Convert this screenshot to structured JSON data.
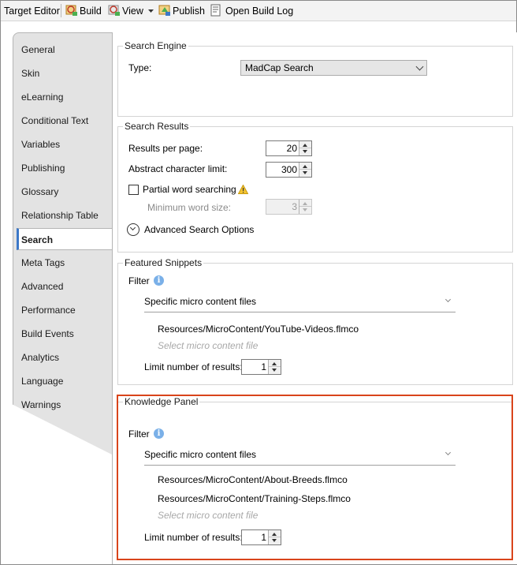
{
  "toolbar": {
    "title": "Target Editor",
    "build": "Build",
    "view": "View",
    "publish": "Publish",
    "open_build_log": "Open Build Log"
  },
  "nav": {
    "items": [
      {
        "label": "General"
      },
      {
        "label": "Skin"
      },
      {
        "label": "eLearning"
      },
      {
        "label": "Conditional Text"
      },
      {
        "label": "Variables"
      },
      {
        "label": "Publishing"
      },
      {
        "label": "Glossary"
      },
      {
        "label": "Relationship Table"
      },
      {
        "label": "Search",
        "active": true
      },
      {
        "label": "Meta Tags"
      },
      {
        "label": "Advanced"
      },
      {
        "label": "Performance"
      },
      {
        "label": "Build Events"
      },
      {
        "label": "Analytics"
      },
      {
        "label": "Language"
      },
      {
        "label": "Warnings"
      }
    ]
  },
  "search_engine": {
    "legend": "Search Engine",
    "type_label": "Type:",
    "type_value": "MadCap Search"
  },
  "search_results": {
    "legend": "Search Results",
    "results_per_page_label": "Results per page:",
    "results_per_page": "20",
    "abstract_limit_label": "Abstract character limit:",
    "abstract_limit": "300",
    "partial_word_label": "Partial word searching",
    "partial_word_checked": false,
    "min_word_size_label": "Minimum word size:",
    "min_word_size": "3",
    "advanced_label": "Advanced Search Options"
  },
  "featured_snippets": {
    "legend": "Featured Snippets",
    "filter_label": "Filter",
    "filter_value": "Specific micro content files",
    "files": [
      "Resources/MicroContent/YouTube-Videos.flmco"
    ],
    "select_hint": "Select micro content file",
    "limit_label": "Limit number of results:",
    "limit_value": "1"
  },
  "knowledge_panel": {
    "legend": "Knowledge Panel",
    "filter_label": "Filter",
    "filter_value": "Specific micro content files",
    "files": [
      "Resources/MicroContent/About-Breeds.flmco",
      "Resources/MicroContent/Training-Steps.flmco"
    ],
    "select_hint": "Select micro content file",
    "limit_label": "Limit number of results:",
    "limit_value": "1"
  },
  "colors": {
    "highlight": "#d9441b",
    "info_icon": "#7ab0e8",
    "active_accent": "#3c78c8"
  },
  "icons": {
    "build": "build-icon",
    "view": "view-icon",
    "publish": "publish-icon",
    "log": "build-log-icon",
    "warning": "warning-icon",
    "info": "info-icon"
  }
}
